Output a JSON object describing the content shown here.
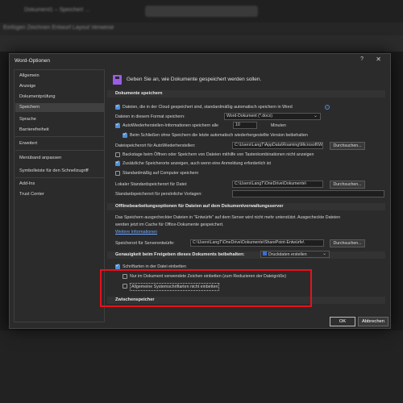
{
  "background": {
    "title_blur": "Dokument1 – Speichert …",
    "ribbon_blur": "Einfügen  Zeichnen  Entwurf  Layout  Verweise"
  },
  "dialog": {
    "title": "Word-Optionen",
    "help": "?",
    "close": "✕",
    "nav": [
      "Allgemein",
      "Anzeige",
      "Dokumentprüfung",
      "Speichern",
      "Sprache",
      "Barrierefreiheit",
      "Erweitert",
      "Menüband anpassen",
      "Symbolleiste für den Schnellzugriff",
      "Add-Ins",
      "Trust Center"
    ],
    "nav_active": "Speichern",
    "header": "Geben Sie an, wie Dokumente gespeichert werden sollen.",
    "sec_save": "Dokumente speichern",
    "autosave_cloud": "Dateien, die in der Cloud gespeichert sind, standardmäßig automatisch speichern in Word",
    "format_label": "Dateien in diesem Format speichern:",
    "format_value": "Word-Dokument (*.docx)",
    "autorecover_label": "AutoWiederherstellen-Informationen speichern alle",
    "autorecover_minutes": "10",
    "minutes_label": "Minuten",
    "keep_last": "Beim Schließen ohne Speichern die letzte automatisch wiederhergestellte Version beibehalten",
    "autorecover_path_label": "Dateispeicherort für AutoWiederherstellen:",
    "autorecover_path": "C:\\Users\\LangT\\AppData\\Roaming\\Microsoft\\Word\\",
    "browse": "Durchsuchen...",
    "backstage": "Backstage beim Öffnen oder Speichern von Dateien mithilfe von Tastenkombinationen nicht anzeigen",
    "more_locations": "Zusätzliche Speicherorte anzeigen, auch wenn eine Anmeldung erforderlich ist",
    "default_computer": "Standardmäßig auf Computer speichern",
    "local_path_label": "Lokaler Standardspeicherort für Datei:",
    "local_path": "C:\\Users\\LangT\\OneDrive\\Dokumente\\",
    "personal_templates_label": "Standardspeicherort für persönliche Vorlagen:",
    "sec_offline": "Offlinebearbeitungsoptionen für Dateien auf dem Dokumentverwaltungsserver",
    "offline_text_1": "Das Speichern ausgecheckter Dateien in \"Entwürfe\" auf dem Server wird nicht mehr unterstützt. Ausgecheckte Dateien",
    "offline_text_2": "werden jetzt im Cache für Office-Dokumente gespeichert.",
    "more_info": "Weitere Informationen",
    "server_drafts_label": "Speicherort für Serverentwürfe:",
    "server_drafts_path": "C:\\Users\\LangT\\OneDrive\\Dokumente\\SharePoint-Entwürfe\\",
    "fidelity_label": "Genauigkeit beim Freigeben dieses Dokuments beibehalten:",
    "fidelity_doc": "Druckdaten erstellen",
    "embed_fonts": "Schriftarten in der Datei einbetten",
    "embed_used_only": "Nur im Dokument verwendete Zeichen einbetten (zum Reduzieren der Dateigröße)",
    "no_system_fonts": "Allgemeine Systemschriftarten nicht einbetten",
    "cache_section": "Zwischenspeicher",
    "ok": "OK",
    "cancel": "Abbrechen"
  },
  "colors": {
    "accent_checkbox": "#4f8fd8",
    "highlight_box": "#e8101d",
    "save_icon": "#9b5de5"
  }
}
